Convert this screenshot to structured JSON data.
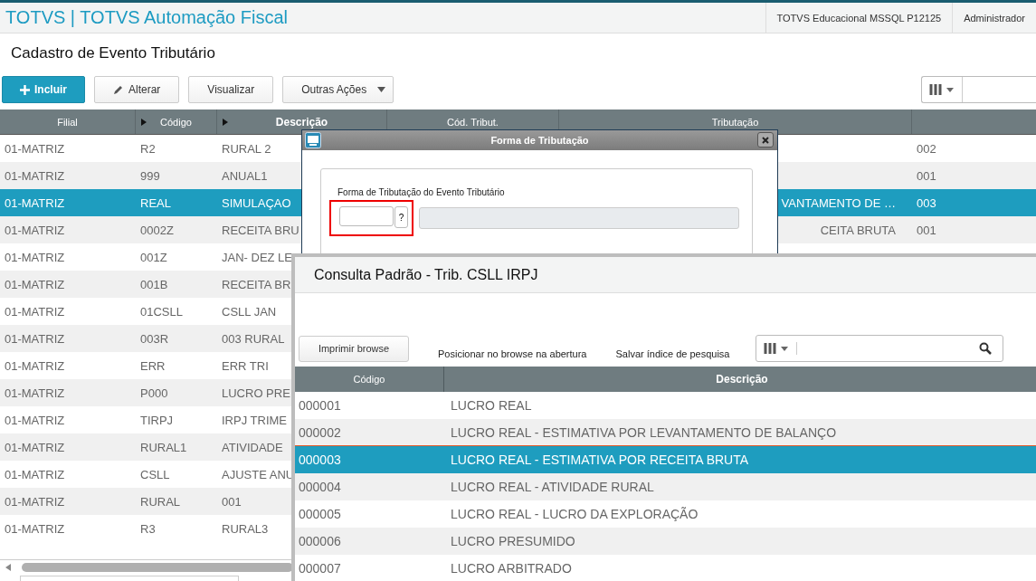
{
  "header": {
    "title": "TOTVS | TOTVS Automação Fiscal",
    "environment": "TOTVS Educacional MSSQL P12125",
    "user": "Administrador"
  },
  "page_title": "Cadastro de Evento Tributário",
  "toolbar": [
    {
      "label": "Incluir",
      "kind": "primary"
    },
    {
      "label": "Alterar",
      "kind": "edit"
    },
    {
      "label": "Visualizar",
      "kind": "plain"
    },
    {
      "label": "Outras Ações",
      "kind": "menu"
    }
  ],
  "table": {
    "columns": [
      {
        "label": "Filial",
        "marker": false,
        "active": false
      },
      {
        "label": "Código",
        "marker": true,
        "active": false
      },
      {
        "label": "Descrição",
        "marker": true,
        "active": true
      },
      {
        "label": "Cód. Tribut.",
        "marker": false,
        "active": false
      },
      {
        "label": "Tributação",
        "marker": false,
        "active": false
      }
    ],
    "rows": [
      {
        "filial": "01-MATRIZ",
        "codigo": "R2",
        "descricao": "RURAL 2",
        "column_6": "002",
        "selected": false
      },
      {
        "filial": "01-MATRIZ",
        "codigo": "999",
        "descricao": "ANUAL1",
        "column_6": "001",
        "selected": false
      },
      {
        "filial": "01-MATRIZ",
        "codigo": "REAL",
        "descricao": "SIMULAÇAO",
        "tributacao": "VANTAMENTO DE …",
        "column_6": "003",
        "selected": true
      },
      {
        "filial": "01-MATRIZ",
        "codigo": "0002Z",
        "descricao": "RECEITA BRU",
        "tributacao": "CEITA BRUTA",
        "column_6": "001",
        "selected": false
      },
      {
        "filial": "01-MATRIZ",
        "codigo": "001Z",
        "descricao": "JAN- DEZ LE",
        "selected": false
      },
      {
        "filial": "01-MATRIZ",
        "codigo": "001B",
        "descricao": "RECEITA BR",
        "selected": false
      },
      {
        "filial": "01-MATRIZ",
        "codigo": "01CSLL",
        "descricao": "CSLL JAN",
        "selected": false
      },
      {
        "filial": "01-MATRIZ",
        "codigo": "003R",
        "descricao": "003 RURAL",
        "selected": false
      },
      {
        "filial": "01-MATRIZ",
        "codigo": "ERR",
        "descricao": "ERR TRI",
        "selected": false
      },
      {
        "filial": "01-MATRIZ",
        "codigo": "P000",
        "descricao": "LUCRO PRE",
        "selected": false
      },
      {
        "filial": "01-MATRIZ",
        "codigo": "TIRPJ",
        "descricao": "IRPJ TRIME",
        "selected": false
      },
      {
        "filial": "01-MATRIZ",
        "codigo": "RURAL1",
        "descricao": "ATIVIDADE",
        "selected": false
      },
      {
        "filial": "01-MATRIZ",
        "codigo": "CSLL",
        "descricao": "AJUSTE ANU",
        "selected": false
      },
      {
        "filial": "01-MATRIZ",
        "codigo": "RURAL",
        "descricao": "001",
        "selected": false
      },
      {
        "filial": "01-MATRIZ",
        "codigo": "R3",
        "descricao": "RURAL3",
        "selected": false
      }
    ]
  },
  "dialog": {
    "title": "Forma de Tributação",
    "field_label": "Forma de Tributação do Evento Tributário",
    "lookup_button": "?",
    "highlighted": true
  },
  "lookup": {
    "title": "Consulta Padrão - Trib. CSLL IRPJ",
    "print_button": "Imprimir browse",
    "options": [
      "Posicionar no browse na abertura",
      "Salvar índice de pesquisa"
    ],
    "columns": [
      "Código",
      "Descrição"
    ],
    "rows": [
      {
        "code": "000001",
        "description": "LUCRO REAL",
        "selected": false
      },
      {
        "code": "000002",
        "description": "LUCRO REAL - ESTIMATIVA POR LEVANTAMENTO DE BALANÇO",
        "selected": false
      },
      {
        "code": "000003",
        "description": "LUCRO REAL - ESTIMATIVA POR RECEITA BRUTA",
        "selected": true
      },
      {
        "code": "000004",
        "description": "LUCRO REAL - ATIVIDADE RURAL",
        "selected": false
      },
      {
        "code": "000005",
        "description": "LUCRO REAL - LUCRO DA EXPLORAÇÃO",
        "selected": false
      },
      {
        "code": "000006",
        "description": "LUCRO PRESUMIDO",
        "selected": false
      },
      {
        "code": "000007",
        "description": "LUCRO ARBITRADO",
        "selected": false
      }
    ]
  }
}
